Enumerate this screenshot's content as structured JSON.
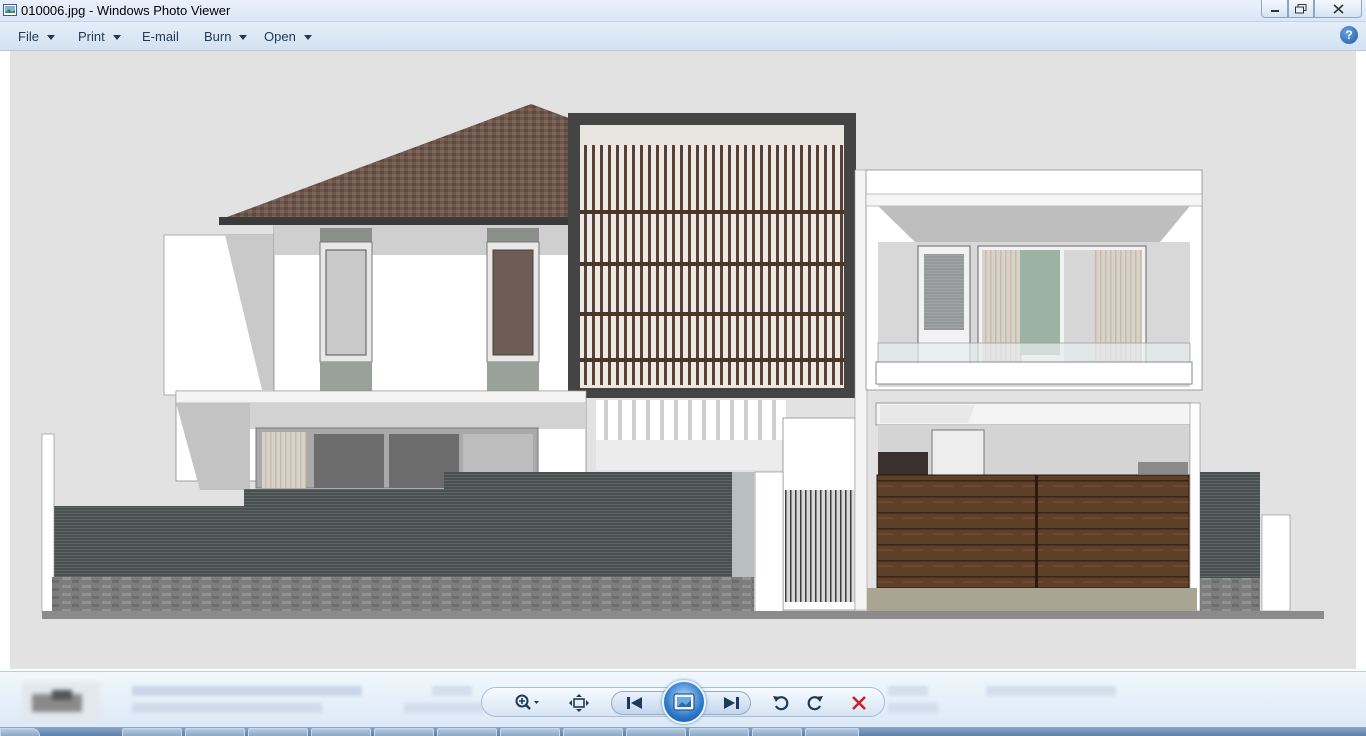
{
  "window": {
    "title": "010006.jpg - Windows Photo Viewer"
  },
  "menu": {
    "file": "File",
    "print": "Print",
    "email": "E-mail",
    "burn": "Burn",
    "open": "Open",
    "help": "?"
  },
  "image": {
    "subject": "architectural rendering of a two-storey house facade"
  },
  "controls": {
    "zoom": "zoom-icon",
    "actual_size": "fit-window-icon",
    "previous": "previous-icon",
    "slideshow": "slideshow-icon",
    "next": "next-icon",
    "rotate_ccw": "rotate-counterclockwise-icon",
    "rotate_cw": "rotate-clockwise-icon",
    "delete": "delete-icon"
  },
  "colors": {
    "chrome": "#dfe9f5",
    "accent": "#1e395b",
    "delete": "#c8222a",
    "roof": "#6b5448",
    "timber": "#5b3e27"
  }
}
